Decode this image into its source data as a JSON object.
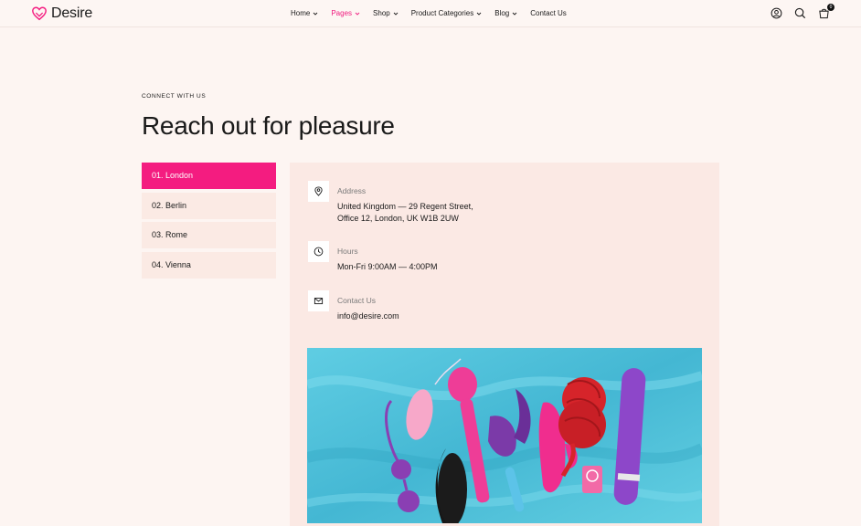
{
  "brand": {
    "name": "Desire",
    "accent": "#f41c80"
  },
  "nav": {
    "items": [
      {
        "label": "Home",
        "has_caret": true
      },
      {
        "label": "Pages",
        "has_caret": true,
        "active": true
      },
      {
        "label": "Shop",
        "has_caret": true
      },
      {
        "label": "Product Categories",
        "has_caret": true
      },
      {
        "label": "Blog",
        "has_caret": true
      },
      {
        "label": "Contact Us",
        "has_caret": false
      }
    ]
  },
  "header_icons": {
    "account": "user-circle-icon",
    "search": "search-icon",
    "cart": "cart-icon",
    "cart_count": "0"
  },
  "page": {
    "eyebrow": "CONNECT WITH US",
    "title": "Reach out for pleasure"
  },
  "locations": {
    "tabs": [
      {
        "label": "01. London",
        "active": true
      },
      {
        "label": "02. Berlin"
      },
      {
        "label": "03. Rome"
      },
      {
        "label": "04. Vienna"
      }
    ]
  },
  "contact": {
    "address": {
      "icon": "map-pin-icon",
      "label": "Address",
      "line1": "United Kingdom — 29 Regent Street,",
      "line2": "Office 12, London, UK W1B 2UW"
    },
    "hours": {
      "icon": "clock-icon",
      "label": "Hours",
      "value": "Mon-Fri 9:00AM — 4:00PM"
    },
    "email": {
      "icon": "mail-icon",
      "label": "Contact Us",
      "value": "info@desire.com"
    }
  },
  "image": {
    "subject": "photo of colorful adult toys on a light blue fabric"
  }
}
